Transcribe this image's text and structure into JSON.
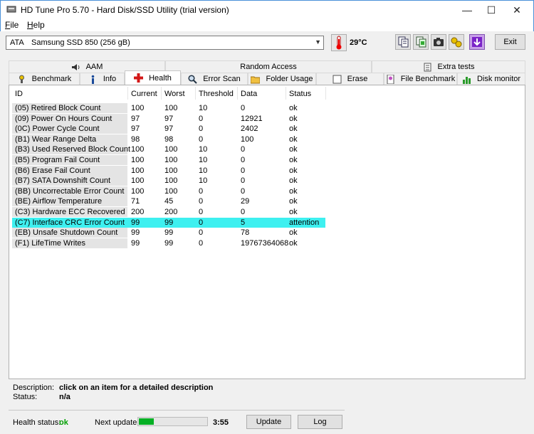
{
  "window": {
    "title": "HD Tune Pro 5.70 - Hard Disk/SSD Utility (trial version)",
    "minimize": "—",
    "maximize": "☐",
    "close": "✕"
  },
  "menu": [
    "File",
    "Help"
  ],
  "toolbar": {
    "drive_type": "ATA",
    "drive_name": "Samsung SSD 850 (256 gB)",
    "temperature": "29°C",
    "exit_label": "Exit",
    "icons": [
      "copy-text-icon",
      "copy-info-icon",
      "screenshot-icon",
      "options-icon",
      "save-icon"
    ]
  },
  "tabs_top": [
    {
      "label": "AAM",
      "icon": "speaker-icon"
    },
    {
      "label": "Random Access",
      "icon": ""
    },
    {
      "label": "Extra tests",
      "icon": "checklist-icon"
    }
  ],
  "tabs_bottom": [
    {
      "label": "Benchmark",
      "icon": "benchmark-icon"
    },
    {
      "label": "Info",
      "icon": "info-icon"
    },
    {
      "label": "Health",
      "icon": "health-cross-icon",
      "active": true
    },
    {
      "label": "Error Scan",
      "icon": "magnifier-icon"
    },
    {
      "label": "Folder Usage",
      "icon": "folder-icon"
    },
    {
      "label": "Erase",
      "icon": "erase-icon"
    },
    {
      "label": "File Benchmark",
      "icon": "file-benchmark-icon"
    },
    {
      "label": "Disk monitor",
      "icon": "disk-monitor-icon"
    }
  ],
  "table": {
    "headers": [
      "ID",
      "Current",
      "Worst",
      "Threshold",
      "Data",
      "Status"
    ],
    "rows": [
      [
        "(05) Retired Block Count",
        "100",
        "100",
        "10",
        "0",
        "ok"
      ],
      [
        "(09) Power On Hours Count",
        "97",
        "97",
        "0",
        "12921",
        "ok"
      ],
      [
        "(0C) Power Cycle Count",
        "97",
        "97",
        "0",
        "2402",
        "ok"
      ],
      [
        "(B1) Wear Range Delta",
        "98",
        "98",
        "0",
        "100",
        "ok"
      ],
      [
        "(B3) Used Reserved Block Count",
        "100",
        "100",
        "10",
        "0",
        "ok"
      ],
      [
        "(B5) Program Fail Count",
        "100",
        "100",
        "10",
        "0",
        "ok"
      ],
      [
        "(B6) Erase Fail Count",
        "100",
        "100",
        "10",
        "0",
        "ok"
      ],
      [
        "(B7) SATA Downshift Count",
        "100",
        "100",
        "10",
        "0",
        "ok"
      ],
      [
        "(BB) Uncorrectable Error Count",
        "100",
        "100",
        "0",
        "0",
        "ok"
      ],
      [
        "(BE) Airflow Temperature",
        "71",
        "45",
        "0",
        "29",
        "ok"
      ],
      [
        "(C3) Hardware ECC Recovered",
        "200",
        "200",
        "0",
        "0",
        "ok"
      ],
      [
        "(C7) Interface CRC Error Count",
        "99",
        "99",
        "0",
        "5",
        "attention"
      ],
      [
        "(EB) Unsafe Shutdown Count",
        "99",
        "99",
        "0",
        "78",
        "ok"
      ],
      [
        "(F1) LifeTime Writes",
        "99",
        "99",
        "0",
        "19767364068",
        "ok"
      ]
    ],
    "selected_row": 11,
    "selected_color": "#3ef0f0"
  },
  "details": {
    "description_label": "Description:",
    "description_value": "click on an item for a detailed description",
    "status_label": "Status:",
    "status_value": "n/a"
  },
  "footer": {
    "health_label": "Health status:",
    "health_value": "ok",
    "health_color": "#00a000",
    "next_update_label": "Next update:",
    "progress": 0.22,
    "countdown": "3:55",
    "update_button": "Update",
    "log_button": "Log"
  }
}
